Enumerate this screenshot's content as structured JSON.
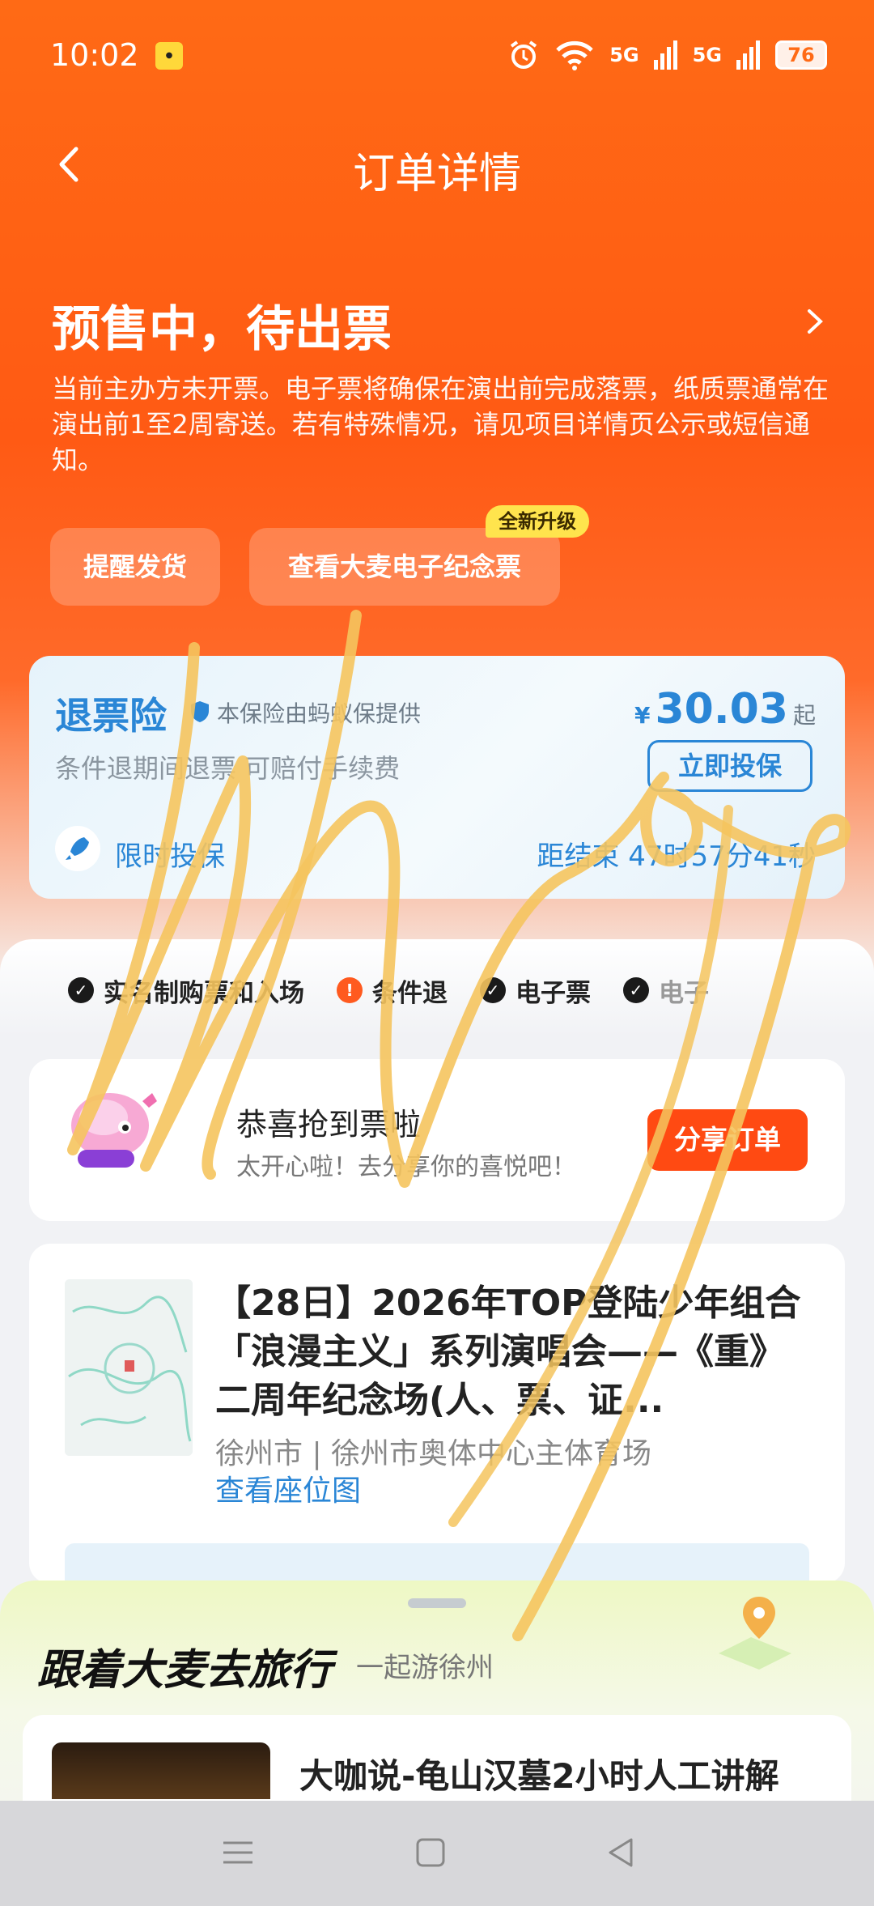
{
  "status_bar": {
    "time": "10:02",
    "signal_1": "5G",
    "signal_2": "5G",
    "battery": "76"
  },
  "nav": {
    "title": "订单详情"
  },
  "order_status": {
    "title": "预售中，待出票",
    "description": "当前主办方未开票。电子票将确保在演出前完成落票，纸质票通常在演出前1至2周寄送。若有特殊情况，请见项目详情页公示或短信通知。"
  },
  "actions": {
    "remind_label": "提醒发货",
    "souvenir_label": "查看大麦电子纪念票",
    "upgrade_badge": "全新升级"
  },
  "insurance": {
    "title": "退票险",
    "provider": "本保险由蚂蚁保提供",
    "currency": "¥",
    "price": "30.03",
    "price_suffix": "起",
    "subtitle": "条件退期间退票 可赔付手续费",
    "buy_label": "立即投保",
    "limited_label": "限时投保",
    "countdown": "距结束 47时57分41秒"
  },
  "features": [
    {
      "label": "实名制购票和入场",
      "type": "check"
    },
    {
      "label": "条件退",
      "type": "warn"
    },
    {
      "label": "电子票",
      "type": "check"
    },
    {
      "label": "电子",
      "type": "check"
    }
  ],
  "share": {
    "title": "恭喜抢到票啦",
    "subtitle": "太开心啦！去分享你的喜悦吧！",
    "button_label": "分享订单"
  },
  "show": {
    "title": "【28日】2026年TOP登陆少年组合「浪漫主义」系列演唱会——《重》二周年纪念场(人、票、证...",
    "venue": "徐州市 | 徐州市奥体中心主体育场",
    "seatmap_label": "查看座位图"
  },
  "travel": {
    "title": "跟着大麦去旅行",
    "subtitle": "一起游徐州",
    "trip_title": "大咖说-龟山汉墓2小时人工讲解"
  },
  "colors": {
    "brand_orange": "#ff5a14",
    "insurance_blue": "#2a86d6",
    "share_red": "#ff4a12",
    "scribble": "#f5c45e"
  }
}
